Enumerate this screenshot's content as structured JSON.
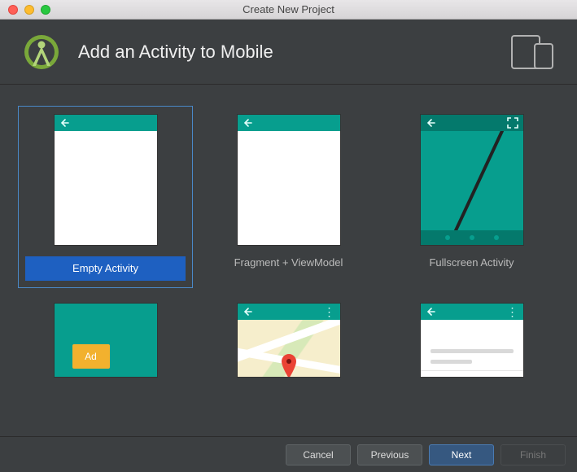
{
  "window": {
    "title": "Create New Project"
  },
  "header": {
    "title": "Add an Activity to Mobile"
  },
  "templates": [
    {
      "label": "Empty Activity",
      "selected": true
    },
    {
      "label": "Fragment + ViewModel",
      "selected": false
    },
    {
      "label": "Fullscreen Activity",
      "selected": false
    }
  ],
  "second_row_ad_label": "Ad",
  "footer": {
    "cancel": "Cancel",
    "previous": "Previous",
    "next": "Next",
    "finish": "Finish"
  }
}
